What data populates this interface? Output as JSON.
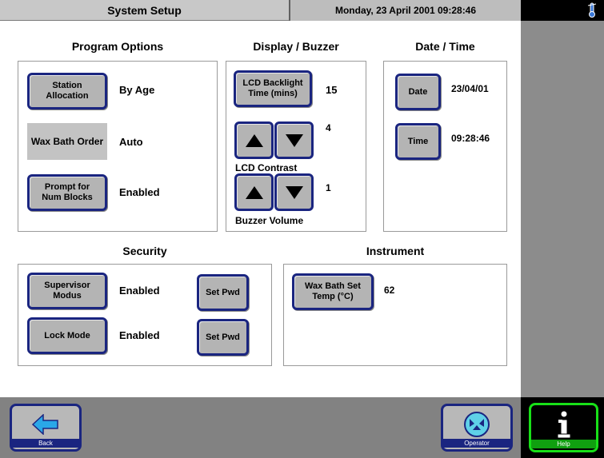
{
  "header": {
    "title": "System Setup",
    "datetime": "Monday, 23 April 2001 09:28:46"
  },
  "program_options": {
    "heading": "Program Options",
    "station_allocation_label": "Station\nAllocation",
    "station_allocation_value": "By Age",
    "wax_bath_order_label": "Wax Bath Order",
    "wax_bath_order_value": "Auto",
    "prompt_num_blocks_label": "Prompt for\nNum Blocks",
    "prompt_num_blocks_value": "Enabled"
  },
  "display_buzzer": {
    "heading": "Display / Buzzer",
    "lcd_backlight_label": "LCD Backlight\nTime (mins)",
    "lcd_backlight_value": "15",
    "lcd_contrast_value": "4",
    "lcd_contrast_label": "LCD Contrast",
    "buzzer_volume_value": "1",
    "buzzer_volume_label": "Buzzer Volume"
  },
  "date_time": {
    "heading": "Date / Time",
    "date_label": "Date",
    "date_value": "23/04/01",
    "time_label": "Time",
    "time_value": "09:28:46"
  },
  "security": {
    "heading": "Security",
    "supervisor_label": "Supervisor\nModus",
    "supervisor_value": "Enabled",
    "supervisor_setpwd": "Set Pwd",
    "lock_mode_label": "Lock Mode",
    "lock_mode_value": "Enabled",
    "lock_mode_setpwd": "Set Pwd"
  },
  "instrument": {
    "heading": "Instrument",
    "wax_bath_temp_label": "Wax Bath Set\nTemp (°C)",
    "wax_bath_temp_value": "62"
  },
  "nav": {
    "back_label": "Back",
    "operator_label": "Operator",
    "help_label": "Help"
  },
  "colors": {
    "button_border": "#1a2580",
    "button_face": "#b4b4b4",
    "help_green": "#18e018",
    "back_arrow": "#2aa8e8"
  },
  "icons": {
    "back": "back-arrow-icon",
    "operator": "operator-icon",
    "help": "info-icon",
    "status": "thermometer-icon"
  }
}
